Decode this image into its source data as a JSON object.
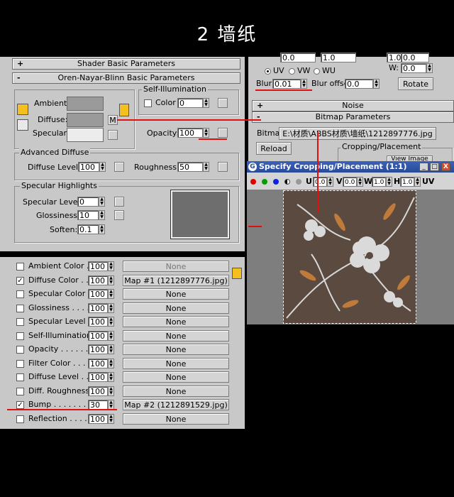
{
  "title": "2 墙纸",
  "material_editor": {
    "rollouts": {
      "shader_basic": {
        "sign": "+",
        "label": "Shader Basic Parameters"
      },
      "oren_nayar": {
        "sign": "-",
        "label": "Oren-Nayar-Blinn Basic Parameters"
      }
    },
    "color_labels": {
      "ambient": "Ambient:",
      "diffuse": "Diffuse:",
      "specular": "Specular:"
    },
    "diffuse_map_button": "M",
    "self_illum": {
      "group": "Self-Illumination",
      "color_label": "Color",
      "value": "0"
    },
    "opacity": {
      "label": "Opacity:",
      "value": "100"
    },
    "advanced_diffuse": {
      "group": "Advanced Diffuse",
      "diffuse_level_label": "Diffuse Level:",
      "diffuse_level": "100",
      "roughness_label": "Roughness:",
      "roughness": "50"
    },
    "specular_highlights": {
      "group": "Specular Highlights",
      "level_label": "Specular Level:",
      "level": "0",
      "glossiness_label": "Glossiness:",
      "glossiness": "10",
      "soften_label": "Soften:",
      "soften": "0.1"
    }
  },
  "maps": [
    {
      "label": "Ambient Color . . .",
      "checked": false,
      "amount": "100",
      "map": "None",
      "dim": true
    },
    {
      "label": "Diffuse Color . . . .",
      "checked": true,
      "amount": "100",
      "map": "Map #1 (1212897776.jpg)",
      "dim": false
    },
    {
      "label": "Specular Color . .",
      "checked": false,
      "amount": "100",
      "map": "None",
      "dim": false
    },
    {
      "label": "Glossiness . . . . .",
      "checked": false,
      "amount": "100",
      "map": "None",
      "dim": false
    },
    {
      "label": "Specular Level . .",
      "checked": false,
      "amount": "100",
      "map": "None",
      "dim": false
    },
    {
      "label": "Self-Illumination .",
      "checked": false,
      "amount": "100",
      "map": "None",
      "dim": false
    },
    {
      "label": "Opacity . . . . . . . .",
      "checked": false,
      "amount": "100",
      "map": "None",
      "dim": false
    },
    {
      "label": "Filter Color . . . . .",
      "checked": false,
      "amount": "100",
      "map": "None",
      "dim": false
    },
    {
      "label": "Diffuse Level . . . .",
      "checked": false,
      "amount": "100",
      "map": "None",
      "dim": false
    },
    {
      "label": "Diff. Roughness .",
      "checked": false,
      "amount": "100",
      "map": "None",
      "dim": false
    },
    {
      "label": "Bump . . . . . . . . .",
      "checked": true,
      "amount": "30",
      "map": "Map #2 (1212891529.jpg)",
      "dim": false
    },
    {
      "label": "Reflection . . . . .",
      "checked": false,
      "amount": "100",
      "map": "None",
      "dim": false
    }
  ],
  "bitmap_panel": {
    "top_values": [
      "0.0",
      "1.0",
      "1.0",
      "0.0"
    ],
    "w_label": "W:",
    "w_value": "0.0",
    "uv_options": [
      "UV",
      "VW",
      "WU"
    ],
    "blur_label": "Blur:",
    "blur_value": "0.01",
    "blur_offset_label": "Blur offset:",
    "blur_offset_value": "0.0",
    "rotate_button": "Rotate",
    "noise_rollout": {
      "sign": "+",
      "label": "Noise"
    },
    "bitmap_rollout": {
      "sign": "-",
      "label": "Bitmap Parameters"
    },
    "bitmap_label": "Bitmap:",
    "bitmap_path": "E:\\材质\\ABBS材质\\墙纸\\1212897776.jpg",
    "reload_button": "Reload",
    "cropping_group": "Cropping/Placement",
    "view_image_button": "View Image"
  },
  "crop_dialog": {
    "title": "Specify Cropping/Placement (1:1)",
    "u_label": "U",
    "u_value": "0.0",
    "v_label": "V",
    "v_value": "0.0",
    "w_label": "W",
    "w_value": "1.0",
    "h_label": "H",
    "h_value": "1.0",
    "uv_label": "UV",
    "window_buttons": [
      "_",
      "□",
      "X"
    ]
  },
  "colors": {
    "accent_red": "#e01010",
    "title_bar": "#2a4a97",
    "panel": "#c8c8c8",
    "wallpaper_bg": "#5a4a40",
    "flower": "#d8d8d8",
    "leaf_orange": "#c07a3a"
  }
}
